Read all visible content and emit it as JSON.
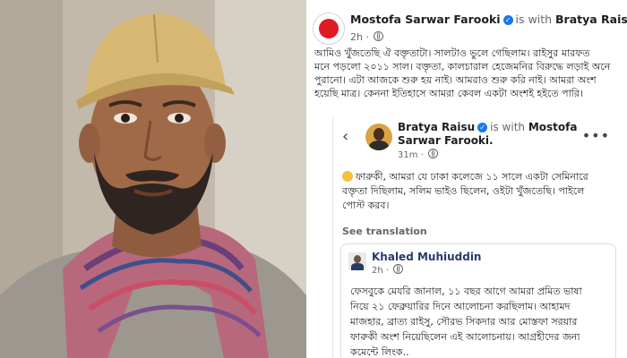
{
  "post": {
    "author": "Mostofa Sarwar Farooki",
    "with_text": "is with",
    "with_name": "Bratya Raisu.",
    "time": "2h",
    "body_lines": [
      "আমিও খুঁজতেছি ঐ বক্তৃতাটা। সালটাও ভুলে গেছিলাম। রাইসুর মারফত",
      "মনে পড়লো ২০১১ সাল। বক্তৃতা, কালচারাল হেজেমনির বিরুদ্ধে লড়াই অনে",
      "পুরানো। এটা আজকে শুরু হয় নাই। আমরাও শুরু করি নাই। আমরা অংশ",
      "হয়েছি মাত্র। কেননা ইতিহাসে আমরা কেবল একটা অংশই হইতে পারি।"
    ]
  },
  "shared": {
    "author": "Bratya Raisu",
    "with_text": "is with",
    "with_name_line1": "Mostofa",
    "with_name_line2": "Sarwar Farooki.",
    "time": "31m",
    "body_lines": [
      "ফারুকী, আমরা যে ঢাকা কলেজে ১১ সালে একটা সেমিনারে",
      "বক্তৃতা দিছিলাম, সলিম ভাইও ছিলেন, ওইটা খুঁজতেছি। পাইলে",
      "পোস্ট করব।"
    ],
    "see_translation": "See translation"
  },
  "card": {
    "author": "Khaled Muhiuddin",
    "time": "2h",
    "body_lines": [
      "ফেসবুকে মেযরি জানাল, ১১ বছর আগে আমরা প্রমিত ভাষা",
      "নিয়ে ২১ ফেব্রুয়ারির দিনে আলোচনা করছিলাম। আহামদ",
      "মাজহার, ব্রাত্য রাইসু, সৌরভ সিকদার আর মোস্তফা সরয়ার",
      "ফারুকী অংশ নিয়েছিলেন এই আলোচনায়। আগ্রহীদের জন্য",
      "কমেন্টে লিংক.."
    ]
  },
  "icons": {
    "verified": "verified-badge-icon",
    "globe": "globe-icon",
    "back": "back-arrow-icon",
    "more": "more-options-icon",
    "emoji": "smile-emoji-icon"
  },
  "colors": {
    "verified_blue": "#1877f2",
    "avatar_red": "#e01a22"
  }
}
